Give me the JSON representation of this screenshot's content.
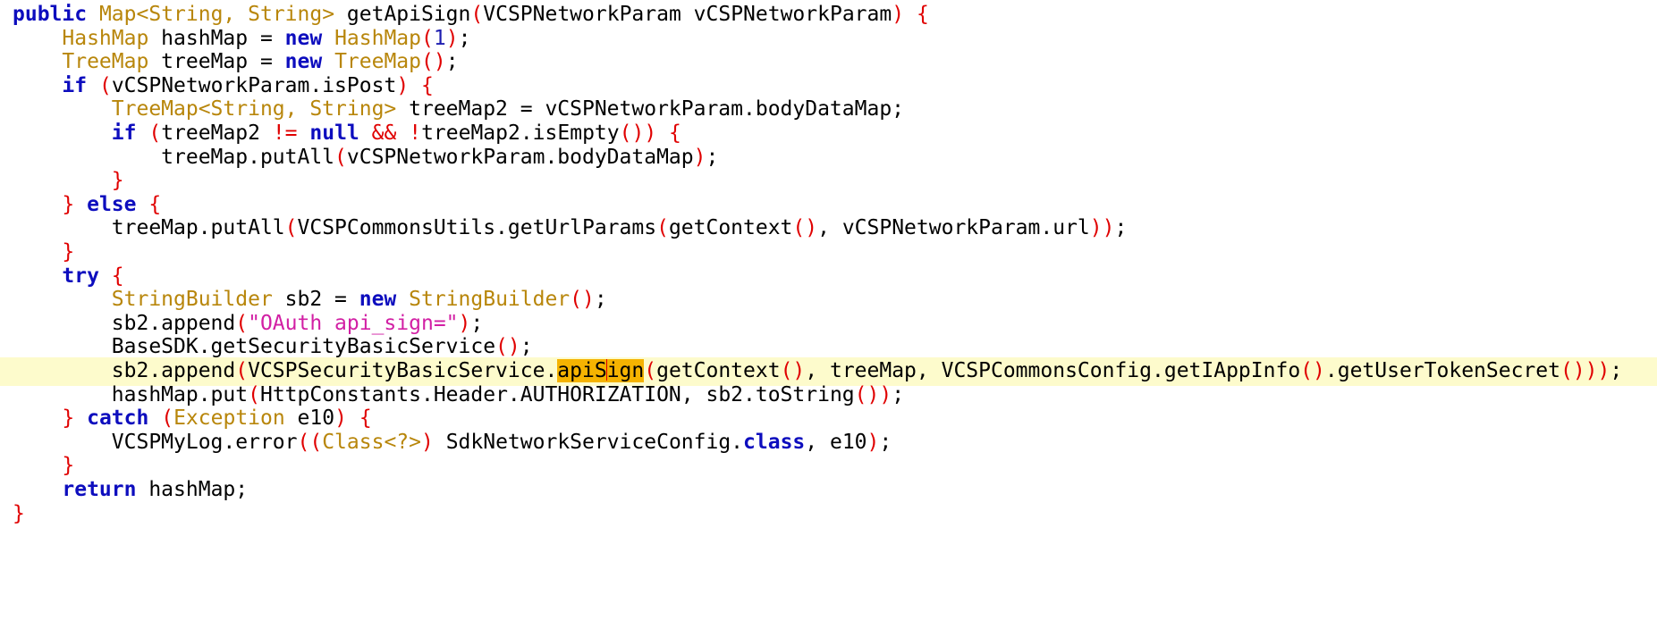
{
  "editor": {
    "highlight_color": "#f5b301",
    "current_line_color": "#fdfbcc",
    "lines": [
      [
        {
          "t": "kw",
          "v": "public"
        },
        {
          "t": "mt",
          "v": " "
        },
        {
          "t": "ty",
          "v": "Map<String, String>"
        },
        {
          "t": "mt",
          "v": " getApiSign"
        },
        {
          "t": "pr",
          "v": "("
        },
        {
          "t": "mt",
          "v": "VCSPNetworkParam vCSPNetworkParam"
        },
        {
          "t": "pr",
          "v": ")"
        },
        {
          "t": "mt",
          "v": " "
        },
        {
          "t": "pr",
          "v": "{"
        }
      ],
      [
        {
          "t": "mt",
          "v": "    "
        },
        {
          "t": "ty",
          "v": "HashMap"
        },
        {
          "t": "mt",
          "v": " hashMap = "
        },
        {
          "t": "kw",
          "v": "new"
        },
        {
          "t": "mt",
          "v": " "
        },
        {
          "t": "ty",
          "v": "HashMap"
        },
        {
          "t": "pr",
          "v": "("
        },
        {
          "t": "nm",
          "v": "1"
        },
        {
          "t": "pr",
          "v": ")"
        },
        {
          "t": "mt",
          "v": ";"
        }
      ],
      [
        {
          "t": "mt",
          "v": "    "
        },
        {
          "t": "ty",
          "v": "TreeMap"
        },
        {
          "t": "mt",
          "v": " treeMap = "
        },
        {
          "t": "kw",
          "v": "new"
        },
        {
          "t": "mt",
          "v": " "
        },
        {
          "t": "ty",
          "v": "TreeMap"
        },
        {
          "t": "pr",
          "v": "()"
        },
        {
          "t": "mt",
          "v": ";"
        }
      ],
      [
        {
          "t": "mt",
          "v": "    "
        },
        {
          "t": "kw",
          "v": "if"
        },
        {
          "t": "mt",
          "v": " "
        },
        {
          "t": "pr",
          "v": "("
        },
        {
          "t": "mt",
          "v": "vCSPNetworkParam.isPost"
        },
        {
          "t": "pr",
          "v": ")"
        },
        {
          "t": "mt",
          "v": " "
        },
        {
          "t": "pr",
          "v": "{"
        }
      ],
      [
        {
          "t": "mt",
          "v": "        "
        },
        {
          "t": "ty",
          "v": "TreeMap<String, String>"
        },
        {
          "t": "mt",
          "v": " treeMap2 = vCSPNetworkParam.bodyDataMap;"
        }
      ],
      [
        {
          "t": "mt",
          "v": "        "
        },
        {
          "t": "kw",
          "v": "if"
        },
        {
          "t": "mt",
          "v": " "
        },
        {
          "t": "pr",
          "v": "("
        },
        {
          "t": "mt",
          "v": "treeMap2 "
        },
        {
          "t": "pr",
          "v": "!="
        },
        {
          "t": "mt",
          "v": " "
        },
        {
          "t": "kw",
          "v": "null"
        },
        {
          "t": "mt",
          "v": " "
        },
        {
          "t": "pr",
          "v": "&&"
        },
        {
          "t": "mt",
          "v": " "
        },
        {
          "t": "pr",
          "v": "!"
        },
        {
          "t": "mt",
          "v": "treeMap2.isEmpty"
        },
        {
          "t": "pr",
          "v": "())"
        },
        {
          "t": "mt",
          "v": " "
        },
        {
          "t": "pr",
          "v": "{"
        }
      ],
      [
        {
          "t": "mt",
          "v": "            treeMap.putAll"
        },
        {
          "t": "pr",
          "v": "("
        },
        {
          "t": "mt",
          "v": "vCSPNetworkParam.bodyDataMap"
        },
        {
          "t": "pr",
          "v": ")"
        },
        {
          "t": "mt",
          "v": ";"
        }
      ],
      [
        {
          "t": "mt",
          "v": "        "
        },
        {
          "t": "pr",
          "v": "}"
        }
      ],
      [
        {
          "t": "mt",
          "v": "    "
        },
        {
          "t": "pr",
          "v": "}"
        },
        {
          "t": "mt",
          "v": " "
        },
        {
          "t": "kw",
          "v": "else"
        },
        {
          "t": "mt",
          "v": " "
        },
        {
          "t": "pr",
          "v": "{"
        }
      ],
      [
        {
          "t": "mt",
          "v": "        treeMap.putAll"
        },
        {
          "t": "pr",
          "v": "("
        },
        {
          "t": "mt",
          "v": "VCSPCommonsUtils.getUrlParams"
        },
        {
          "t": "pr",
          "v": "("
        },
        {
          "t": "mt",
          "v": "getContext"
        },
        {
          "t": "pr",
          "v": "()"
        },
        {
          "t": "mt",
          "v": ", vCSPNetworkParam.url"
        },
        {
          "t": "pr",
          "v": "))"
        },
        {
          "t": "mt",
          "v": ";"
        }
      ],
      [
        {
          "t": "mt",
          "v": "    "
        },
        {
          "t": "pr",
          "v": "}"
        }
      ],
      [
        {
          "t": "mt",
          "v": "    "
        },
        {
          "t": "kw",
          "v": "try"
        },
        {
          "t": "mt",
          "v": " "
        },
        {
          "t": "pr",
          "v": "{"
        }
      ],
      [
        {
          "t": "mt",
          "v": "        "
        },
        {
          "t": "ty",
          "v": "StringBuilder"
        },
        {
          "t": "mt",
          "v": " sb2 = "
        },
        {
          "t": "kw",
          "v": "new"
        },
        {
          "t": "mt",
          "v": " "
        },
        {
          "t": "ty",
          "v": "StringBuilder"
        },
        {
          "t": "pr",
          "v": "()"
        },
        {
          "t": "mt",
          "v": ";"
        }
      ],
      [
        {
          "t": "mt",
          "v": "        sb2.append"
        },
        {
          "t": "pr",
          "v": "("
        },
        {
          "t": "st",
          "v": "\"OAuth api_sign=\""
        },
        {
          "t": "pr",
          "v": ")"
        },
        {
          "t": "mt",
          "v": ";"
        }
      ],
      [
        {
          "t": "mt",
          "v": "        BaseSDK.getSecurityBasicService"
        },
        {
          "t": "pr",
          "v": "()"
        },
        {
          "t": "mt",
          "v": ";"
        }
      ],
      [
        {
          "t": "mt",
          "v": "        sb2.append"
        },
        {
          "t": "pr",
          "v": "("
        },
        {
          "t": "mt",
          "v": "VCSPSecurityBasicService."
        },
        {
          "t": "hl",
          "v": "apiS"
        },
        {
          "t": "caret",
          "v": ""
        },
        {
          "t": "hl",
          "v": "ign"
        },
        {
          "t": "pr",
          "v": "("
        },
        {
          "t": "mt",
          "v": "getContext"
        },
        {
          "t": "pr",
          "v": "()"
        },
        {
          "t": "mt",
          "v": ", treeMap, VCSPCommonsConfig.getIAppInfo"
        },
        {
          "t": "pr",
          "v": "()"
        },
        {
          "t": "mt",
          "v": ".getUserTokenSecret"
        },
        {
          "t": "pr",
          "v": "()))"
        },
        {
          "t": "mt",
          "v": ";"
        }
      ],
      [
        {
          "t": "mt",
          "v": "        hashMap.put"
        },
        {
          "t": "pr",
          "v": "("
        },
        {
          "t": "mt",
          "v": "HttpConstants.Header.AUTHORIZATION, sb2.toString"
        },
        {
          "t": "pr",
          "v": "())"
        },
        {
          "t": "mt",
          "v": ";"
        }
      ],
      [
        {
          "t": "mt",
          "v": "    "
        },
        {
          "t": "pr",
          "v": "}"
        },
        {
          "t": "mt",
          "v": " "
        },
        {
          "t": "kw",
          "v": "catch"
        },
        {
          "t": "mt",
          "v": " "
        },
        {
          "t": "pr",
          "v": "("
        },
        {
          "t": "ty",
          "v": "Exception"
        },
        {
          "t": "mt",
          "v": " e10"
        },
        {
          "t": "pr",
          "v": ")"
        },
        {
          "t": "mt",
          "v": " "
        },
        {
          "t": "pr",
          "v": "{"
        }
      ],
      [
        {
          "t": "mt",
          "v": "        VCSPMyLog.error"
        },
        {
          "t": "pr",
          "v": "(("
        },
        {
          "t": "ty",
          "v": "Class<?>"
        },
        {
          "t": "pr",
          "v": ")"
        },
        {
          "t": "mt",
          "v": " SdkNetworkServiceConfig."
        },
        {
          "t": "kw",
          "v": "class"
        },
        {
          "t": "mt",
          "v": ", e10"
        },
        {
          "t": "pr",
          "v": ")"
        },
        {
          "t": "mt",
          "v": ";"
        }
      ],
      [
        {
          "t": "mt",
          "v": "    "
        },
        {
          "t": "pr",
          "v": "}"
        }
      ],
      [
        {
          "t": "mt",
          "v": "    "
        },
        {
          "t": "kw",
          "v": "return"
        },
        {
          "t": "mt",
          "v": " hashMap;"
        }
      ],
      [
        {
          "t": "pr",
          "v": "}"
        }
      ]
    ],
    "current_line_index": 15
  }
}
